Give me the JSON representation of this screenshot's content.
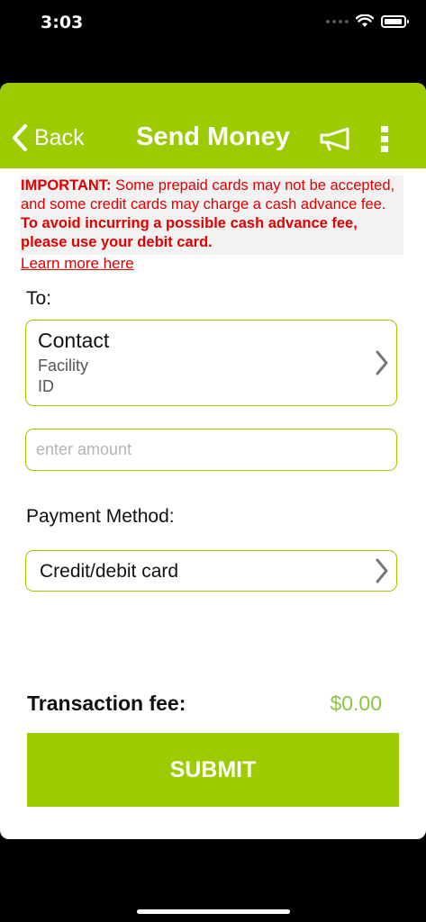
{
  "status_bar": {
    "time": "3:03"
  },
  "header": {
    "back_label": "Back",
    "title": "Send Money",
    "icons": {
      "back": "chevron-left-icon",
      "announce": "megaphone-icon",
      "more": "more-vertical-icon"
    }
  },
  "notice": {
    "important_label": "IMPORTANT:",
    "message": " Some prepaid cards may not be accepted, and some credit cards may charge a cash advance fee.  ",
    "emphasis": "To avoid incurring a possible cash advance fee, please use your debit card.",
    "learn_more": "Learn more here"
  },
  "form": {
    "to_label": "To:",
    "contact": {
      "name": "Contact",
      "line1": "Facility",
      "line2": "ID"
    },
    "amount": {
      "placeholder": "enter amount",
      "value": ""
    },
    "payment_method_label": "Payment Method:",
    "payment_method_value": "Credit/debit card"
  },
  "fee": {
    "label": "Transaction fee:",
    "value": "$0.00"
  },
  "submit_label": "SUBMIT",
  "colors": {
    "brand_green": "#9ccb00",
    "fee_green": "#8cc63f",
    "notice_red": "#e00000"
  }
}
